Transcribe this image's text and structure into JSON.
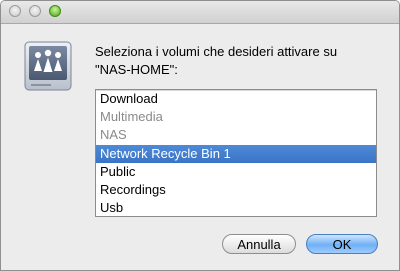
{
  "dialog": {
    "message": "Seleziona i volumi che desideri attivare su\n\"NAS-HOME\":",
    "icon": "network-server-icon"
  },
  "volumes": [
    {
      "label": "Download",
      "state": "enabled"
    },
    {
      "label": "Multimedia",
      "state": "disabled"
    },
    {
      "label": "NAS",
      "state": "disabled"
    },
    {
      "label": "Network Recycle Bin 1",
      "state": "selected"
    },
    {
      "label": "Public",
      "state": "enabled"
    },
    {
      "label": "Recordings",
      "state": "enabled"
    },
    {
      "label": "Usb",
      "state": "enabled"
    }
  ],
  "buttons": {
    "cancel_label": "Annulla",
    "ok_label": "OK"
  },
  "colors": {
    "selection": "#3a74c6",
    "default_button": "#6fb0f5",
    "zoom_button": "#4fa41a"
  }
}
